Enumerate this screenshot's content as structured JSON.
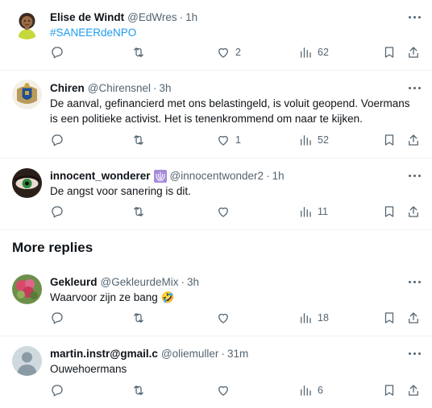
{
  "tweets": [
    {
      "name": "Elise de Windt",
      "handle": "@EdWres",
      "separator": "·",
      "time": "1h",
      "text": "#SANEERdeNPO",
      "replies": "",
      "retweets": "",
      "likes": "2",
      "views": "62",
      "avatar_icon": "avatar-illustration-woman"
    },
    {
      "name": "Chiren",
      "handle": "@Chirensnel",
      "separator": "·",
      "time": "3h",
      "text": "De aanval, gefinancierd met ons belastingeld, is voluit geopend. Voermans is een politieke activist. Het is tenenkrommend om naar te kijken.",
      "replies": "",
      "retweets": "",
      "likes": "1",
      "views": "52",
      "avatar_icon": "coat-of-arms-avatar"
    },
    {
      "name": "innocent_wonderer",
      "handle": "@innocentwonder2",
      "separator": "·",
      "time": "1h",
      "text": "De angst voor sanering is dit.",
      "replies": "",
      "retweets": "",
      "likes": "",
      "views": "11",
      "avatar_icon": "eye-avatar",
      "badge_icon": "menorah-icon"
    }
  ],
  "more_replies": {
    "title": "More replies",
    "tweets": [
      {
        "name": "Gekleurd",
        "handle": "@GekleurdeMix",
        "separator": "·",
        "time": "3h",
        "text": "Waarvoor zijn ze bang",
        "emoji": "🤣",
        "replies": "",
        "retweets": "",
        "likes": "",
        "views": "18",
        "avatar_icon": "flower-avatar"
      },
      {
        "name": "martin.instr@gmail.c",
        "handle": "@oliemuller",
        "separator": "·",
        "time": "31m",
        "text": "Ouwehoermans",
        "replies": "",
        "retweets": "",
        "likes": "",
        "views": "6",
        "avatar_icon": "default-avatar"
      }
    ]
  },
  "colors": {
    "text": "#0f1419",
    "secondary": "#536471",
    "accent": "#1d9bf0",
    "divider": "#eff3f4"
  }
}
